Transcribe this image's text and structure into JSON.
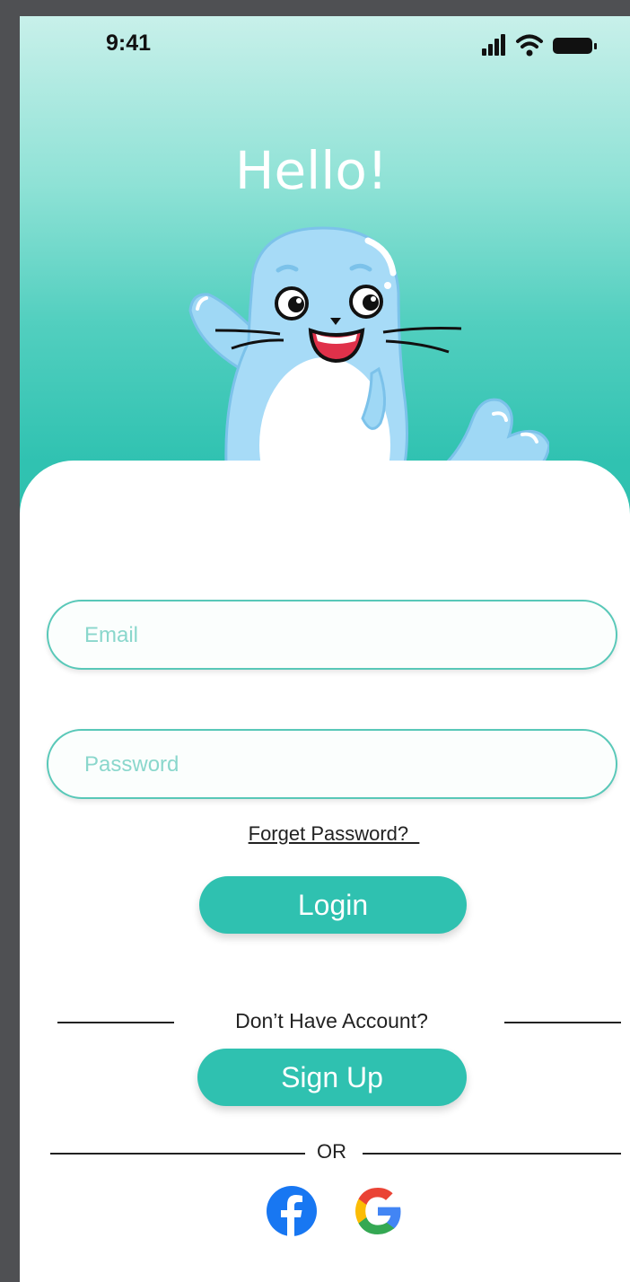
{
  "status_bar": {
    "time": "9:41",
    "icons": [
      "cellular-signal-icon",
      "wifi-icon",
      "battery-icon"
    ]
  },
  "header": {
    "greeting": "Hello!",
    "mascot": "seal-mascot"
  },
  "form": {
    "email_placeholder": "Email",
    "password_placeholder": "Password",
    "forget_password_label": "Forget Password?  ",
    "login_label": "Login"
  },
  "signup": {
    "prompt": "Don’t Have Account?",
    "button_label": "Sign Up"
  },
  "alt_login": {
    "or_label": "OR",
    "providers": [
      "Facebook",
      "Google"
    ]
  },
  "colors": {
    "accent": "#2fc1b0",
    "field_border": "#58c8b8",
    "placeholder": "#8ad7cc",
    "facebook": "#1877f2"
  }
}
